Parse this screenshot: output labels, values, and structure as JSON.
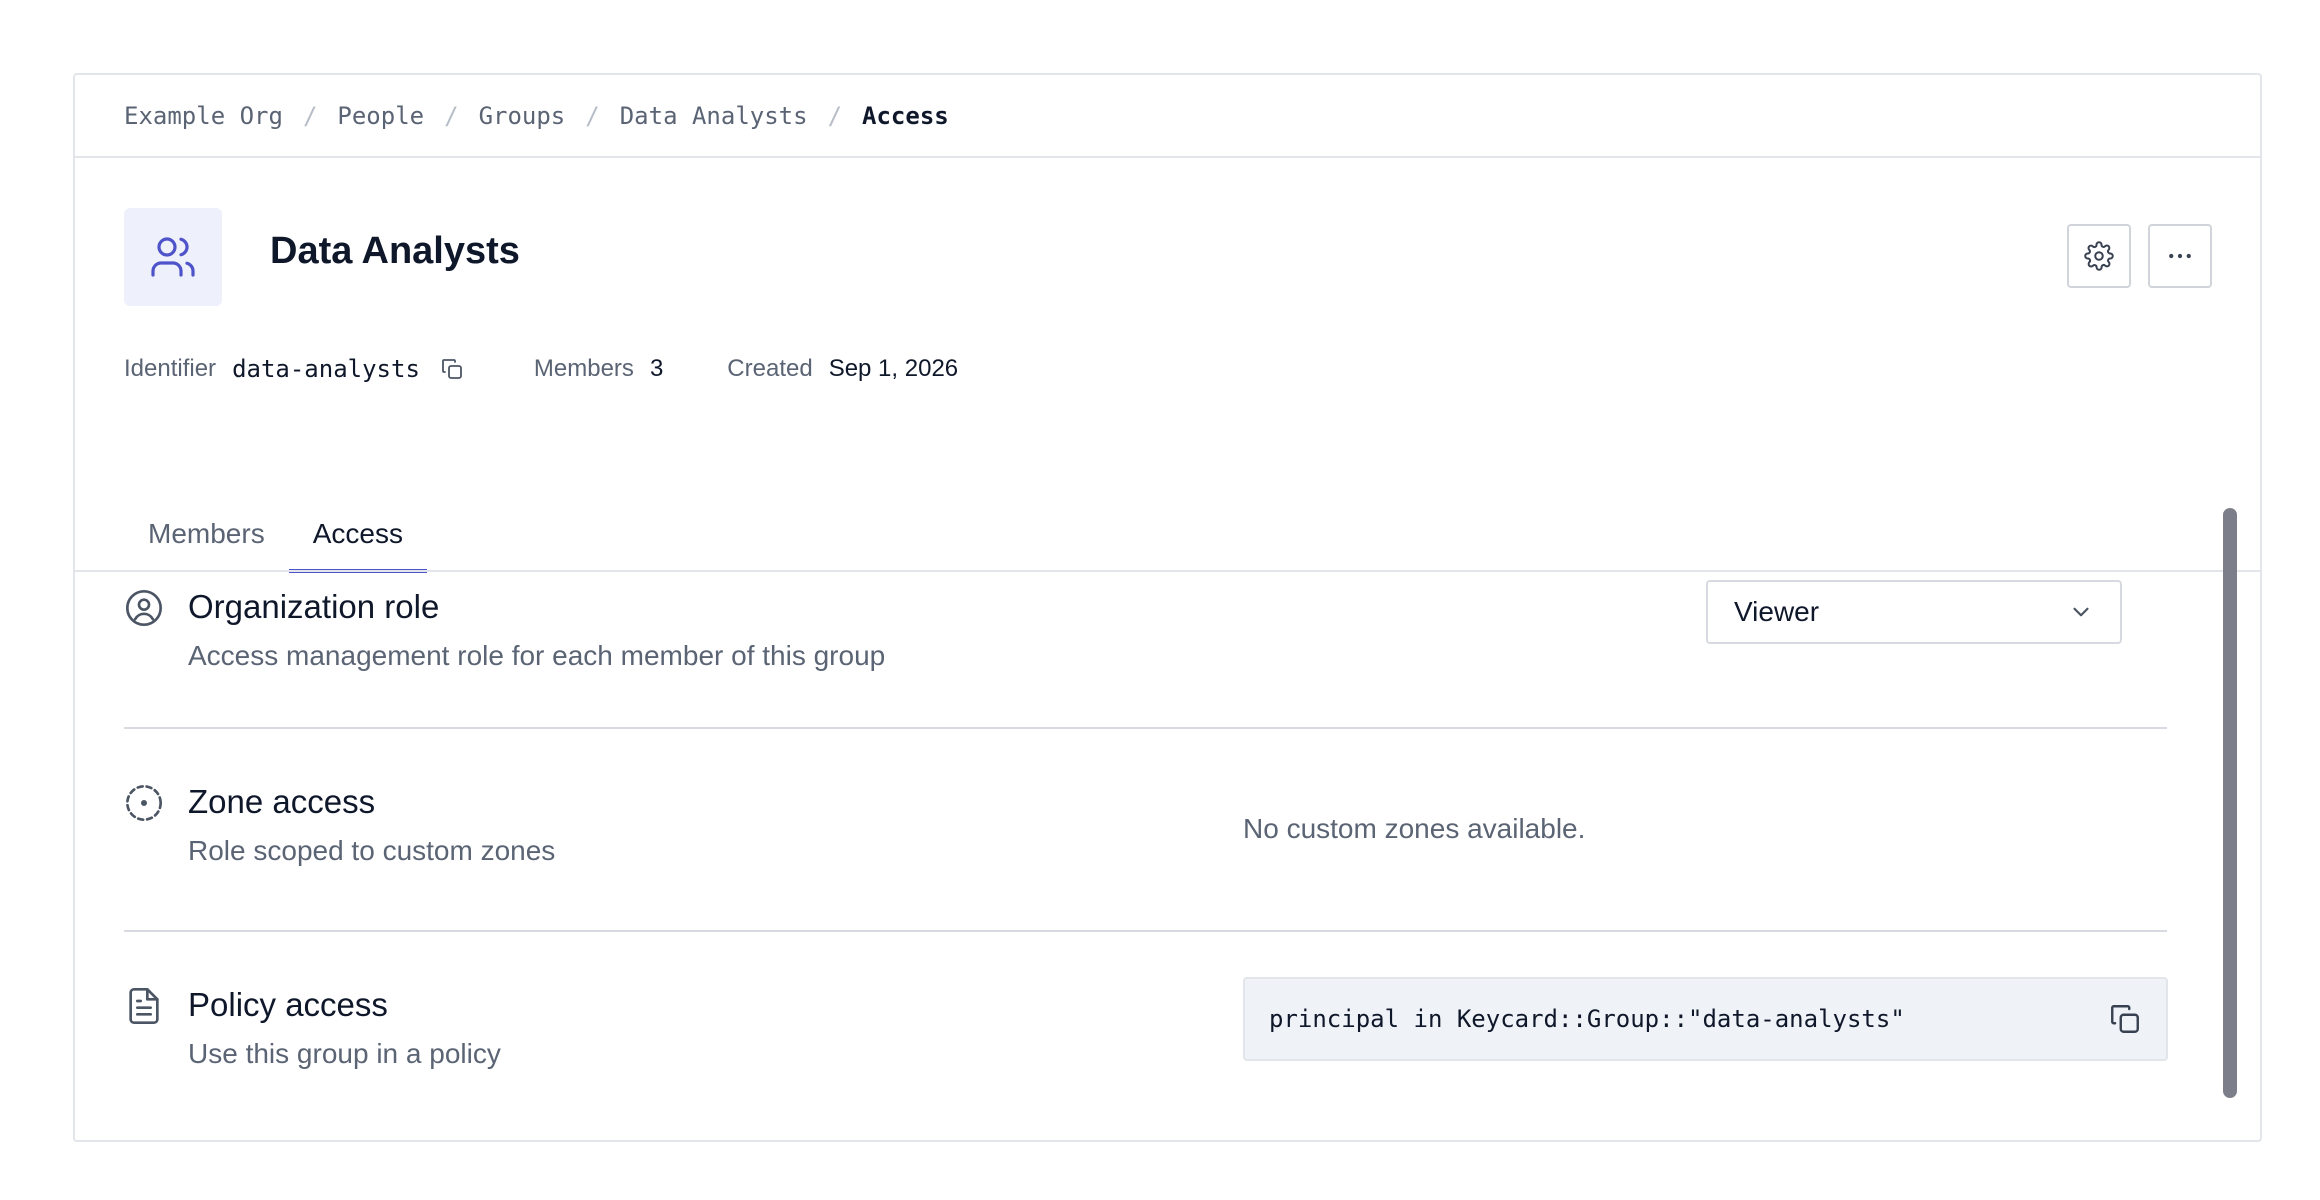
{
  "breadcrumb": {
    "items": [
      "Example Org",
      "People",
      "Groups",
      "Data Analysts"
    ],
    "current": "Access",
    "separator": "/"
  },
  "group": {
    "name": "Data Analysts",
    "icon": "users-icon"
  },
  "meta": {
    "identifier_label": "Identifier",
    "identifier_value": "data-analysts",
    "members_label": "Members",
    "members_value": "3",
    "created_label": "Created",
    "created_value": "Sep 1, 2026"
  },
  "tabs": [
    {
      "label": "Members",
      "active": false
    },
    {
      "label": "Access",
      "active": true
    }
  ],
  "sections": {
    "org_role": {
      "title": "Organization role",
      "description": "Access management role for each member of this group",
      "selected": "Viewer"
    },
    "zone_access": {
      "title": "Zone access",
      "description": "Role scoped to custom zones",
      "empty_text": "No custom zones available."
    },
    "policy_access": {
      "title": "Policy access",
      "description": "Use this group in a policy",
      "code": "principal in Keycard::Group::\"data-analysts\""
    }
  },
  "colors": {
    "accent": "#4f53c9",
    "avatar_bg": "#eef0fb",
    "muted_text": "#5b6474",
    "border": "#e2e5ea"
  }
}
